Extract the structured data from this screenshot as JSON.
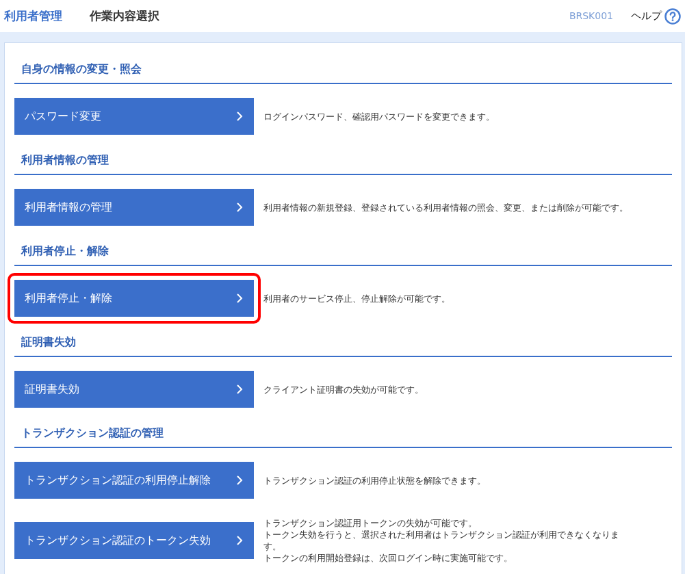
{
  "header": {
    "title": "利用者管理",
    "subtitle": "作業内容選択",
    "screen_id": "BRSK001",
    "help": "ヘルプ"
  },
  "sections": [
    {
      "heading": "自身の情報の変更・照会",
      "items": [
        {
          "label": "パスワード変更",
          "description": [
            "ログインパスワード、確認用パスワードを変更できます。"
          ],
          "highlighted": false
        }
      ]
    },
    {
      "heading": "利用者情報の管理",
      "items": [
        {
          "label": "利用者情報の管理",
          "description": [
            "利用者情報の新規登録、登録されている利用者情報の照会、変更、または削除が可能です。"
          ],
          "highlighted": false
        }
      ]
    },
    {
      "heading": "利用者停止・解除",
      "items": [
        {
          "label": "利用者停止・解除",
          "description": [
            "利用者のサービス停止、停止解除が可能です。"
          ],
          "highlighted": true
        }
      ]
    },
    {
      "heading": "証明書失効",
      "items": [
        {
          "label": "証明書失効",
          "description": [
            "クライアント証明書の失効が可能です。"
          ],
          "highlighted": false
        }
      ]
    },
    {
      "heading": "トランザクション認証の管理",
      "items": [
        {
          "label": "トランザクション認証の利用停止解除",
          "description": [
            "トランザクション認証の利用停止状態を解除できます。"
          ],
          "highlighted": false
        },
        {
          "label": "トランザクション認証のトークン失効",
          "description": [
            "トランザクション認証用トークンの失効が可能です。",
            "トークン失効を行うと、選択された利用者はトランザクション認証が利用できなくなりま",
            "す。",
            "トークンの利用開始登録は、次回ログイン時に実施可能です。"
          ],
          "highlighted": false
        }
      ]
    }
  ]
}
